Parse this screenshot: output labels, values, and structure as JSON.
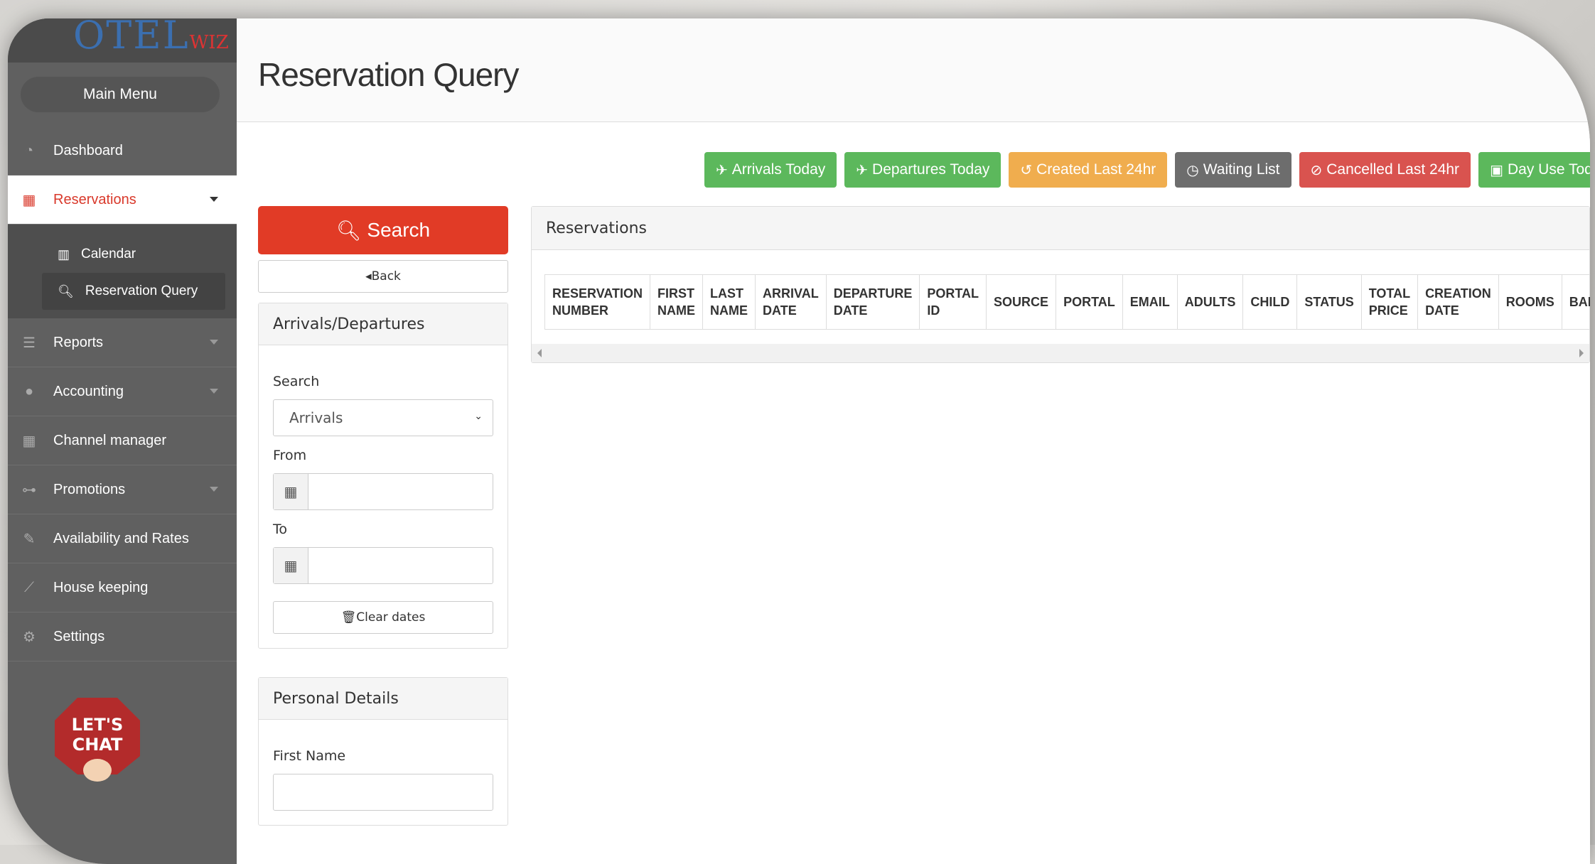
{
  "brand": {
    "logo_main": "OTEL",
    "logo_sub": "WIZ"
  },
  "sidebar": {
    "main_menu": "Main Menu",
    "items": [
      {
        "label": "Dashboard",
        "icon": "dashboard-icon"
      },
      {
        "label": "Reservations",
        "icon": "building-icon",
        "active": true
      },
      {
        "label": "Reports",
        "icon": "list-icon"
      },
      {
        "label": "Accounting",
        "icon": "user-icon"
      },
      {
        "label": "Channel manager",
        "icon": "building-icon"
      },
      {
        "label": "Promotions",
        "icon": "sitemap-icon"
      },
      {
        "label": "Availability and Rates",
        "icon": "pencil-icon"
      },
      {
        "label": "House keeping",
        "icon": "broom-icon"
      },
      {
        "label": "Settings",
        "icon": "gear-icon"
      }
    ],
    "subitems": [
      {
        "label": "Calendar",
        "icon": "map-icon"
      },
      {
        "label": "Reservation Query",
        "icon": "search-icon"
      }
    ],
    "chat_badge": "LET'S CHAT"
  },
  "page": {
    "title": "Reservation Query"
  },
  "quick_filters": [
    {
      "label": "Arrivals Today",
      "icon": "plane-landing-icon",
      "color": "#5cb85c"
    },
    {
      "label": "Departures Today",
      "icon": "plane-departure-icon",
      "color": "#5cb85c"
    },
    {
      "label": "Created Last 24hr",
      "icon": "history-icon",
      "color": "#f0ad4e"
    },
    {
      "label": "Waiting List",
      "icon": "clock-icon",
      "color": "#6d6d6d"
    },
    {
      "label": "Cancelled Last 24hr",
      "icon": "ban-icon",
      "color": "#d9534f"
    },
    {
      "label": "Day Use Today",
      "icon": "calendar-icon",
      "color": "#5cb85c"
    }
  ],
  "search": {
    "button": "Search",
    "back": "Back",
    "arrivals_panel": {
      "title": "Arrivals/Departures",
      "search_label": "Search",
      "search_value": "Arrivals",
      "from_label": "From",
      "to_label": "To",
      "clear": "Clear dates"
    },
    "personal_panel": {
      "title": "Personal Details",
      "first_name_label": "First Name"
    }
  },
  "reservations": {
    "title": "Reservations",
    "columns": [
      [
        "RESERVATION",
        "NUMBER"
      ],
      [
        "FIRST",
        "NAME"
      ],
      [
        "LAST",
        "NAME"
      ],
      [
        "ARRIVAL",
        "DATE"
      ],
      [
        "DEPARTURE",
        "DATE"
      ],
      [
        "PORTAL",
        "ID"
      ],
      [
        "SOURCE",
        ""
      ],
      [
        "PORTAL",
        ""
      ],
      [
        "EMAIL",
        ""
      ],
      [
        "ADULTS",
        ""
      ],
      [
        "CHILD",
        ""
      ],
      [
        "STATUS",
        ""
      ],
      [
        "TOTAL",
        "PRICE"
      ],
      [
        "CREATION",
        "DATE"
      ],
      [
        "ROOMS",
        ""
      ],
      [
        "BALANCE",
        ""
      ]
    ]
  }
}
